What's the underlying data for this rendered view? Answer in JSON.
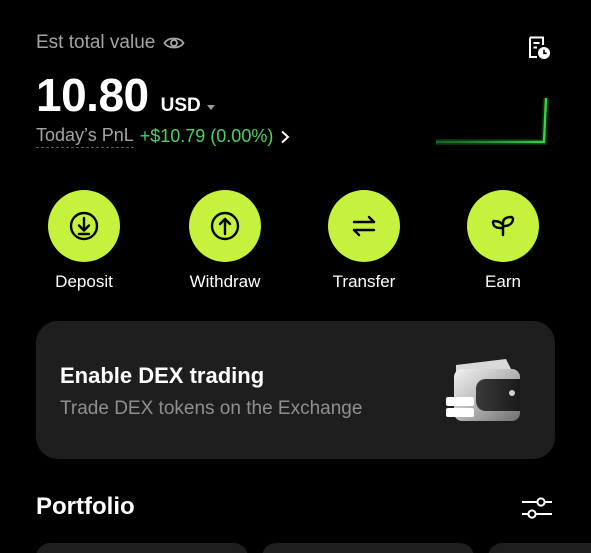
{
  "header": {
    "est_label": "Est total value",
    "icons": {
      "eye": "eye-icon",
      "history": "history-icon"
    }
  },
  "balance": {
    "amount": "10.80",
    "currency": "USD"
  },
  "pnl": {
    "label": "Today’s PnL",
    "value": "+$10.79 (0.00%)",
    "value_color": "#4fd15f"
  },
  "actions": [
    {
      "label": "Deposit",
      "icon": "deposit-icon"
    },
    {
      "label": "Withdraw",
      "icon": "withdraw-icon"
    },
    {
      "label": "Transfer",
      "icon": "transfer-icon"
    },
    {
      "label": "Earn",
      "icon": "earn-icon"
    }
  ],
  "dex_card": {
    "title": "Enable DEX trading",
    "subtitle": "Trade DEX tokens on the Exchange",
    "icon": "wallet-icon"
  },
  "portfolio": {
    "title": "Portfolio",
    "icon": "filter-icon"
  },
  "colors": {
    "accent": "#c4f23d",
    "background": "#000000",
    "card": "#1e1e1e",
    "positive": "#4fd15f",
    "muted_text": "#a4a4a4"
  }
}
